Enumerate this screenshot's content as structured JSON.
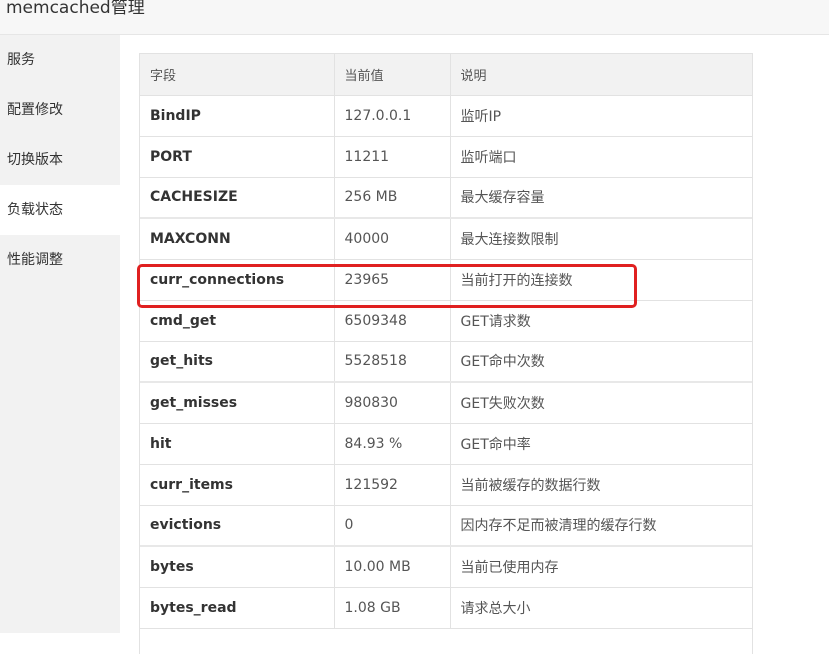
{
  "app": {
    "title": "memcached管理"
  },
  "sidebar": {
    "items": [
      {
        "label": "服务"
      },
      {
        "label": "配置修改"
      },
      {
        "label": "切换版本"
      },
      {
        "label": "负载状态"
      },
      {
        "label": "性能调整"
      }
    ],
    "active": "负载状态"
  },
  "table": {
    "headers": [
      "字段",
      "当前值",
      "说明"
    ],
    "rows": [
      {
        "field": "BindIP",
        "value": "127.0.0.1",
        "desc": "监听IP"
      },
      {
        "field": "PORT",
        "value": "11211",
        "desc": "监听端口"
      },
      {
        "field": "CACHESIZE",
        "value": "256 MB",
        "desc": "最大缓存容量"
      },
      {
        "field": "MAXCONN",
        "value": "40000",
        "desc": "最大连接数限制"
      },
      {
        "field": "curr_connections",
        "value": "23965",
        "desc": "当前打开的连接数"
      },
      {
        "field": "cmd_get",
        "value": "6509348",
        "desc": "GET请求数"
      },
      {
        "field": "get_hits",
        "value": "5528518",
        "desc": "GET命中次数"
      },
      {
        "field": "get_misses",
        "value": "980830",
        "desc": "GET失败次数"
      },
      {
        "field": "hit",
        "value": "84.93 %",
        "desc": "GET命中率"
      },
      {
        "field": "curr_items",
        "value": "121592",
        "desc": "当前被缓存的数据行数"
      },
      {
        "field": "evictions",
        "value": "0",
        "desc": "因内存不足而被清理的缓存行数"
      },
      {
        "field": "bytes",
        "value": "10.00 MB",
        "desc": "当前已使用内存"
      },
      {
        "field": "bytes_read",
        "value": "1.08 GB",
        "desc": "请求总大小"
      }
    ]
  },
  "highlight": {
    "color": "#e02020",
    "target_field": "curr_connections"
  }
}
